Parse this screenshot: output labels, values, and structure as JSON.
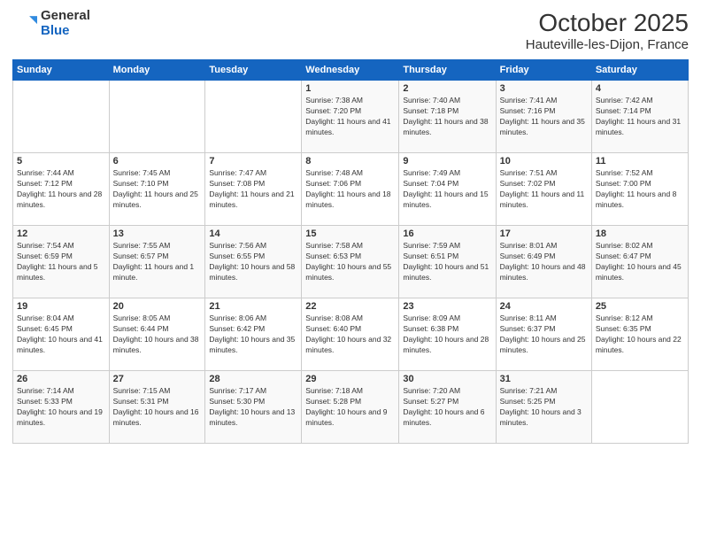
{
  "header": {
    "logo_general": "General",
    "logo_blue": "Blue",
    "month": "October 2025",
    "location": "Hauteville-les-Dijon, France"
  },
  "weekdays": [
    "Sunday",
    "Monday",
    "Tuesday",
    "Wednesday",
    "Thursday",
    "Friday",
    "Saturday"
  ],
  "weeks": [
    [
      {
        "day": "",
        "content": ""
      },
      {
        "day": "",
        "content": ""
      },
      {
        "day": "",
        "content": ""
      },
      {
        "day": "1",
        "content": "Sunrise: 7:38 AM\nSunset: 7:20 PM\nDaylight: 11 hours and 41 minutes."
      },
      {
        "day": "2",
        "content": "Sunrise: 7:40 AM\nSunset: 7:18 PM\nDaylight: 11 hours and 38 minutes."
      },
      {
        "day": "3",
        "content": "Sunrise: 7:41 AM\nSunset: 7:16 PM\nDaylight: 11 hours and 35 minutes."
      },
      {
        "day": "4",
        "content": "Sunrise: 7:42 AM\nSunset: 7:14 PM\nDaylight: 11 hours and 31 minutes."
      }
    ],
    [
      {
        "day": "5",
        "content": "Sunrise: 7:44 AM\nSunset: 7:12 PM\nDaylight: 11 hours and 28 minutes."
      },
      {
        "day": "6",
        "content": "Sunrise: 7:45 AM\nSunset: 7:10 PM\nDaylight: 11 hours and 25 minutes."
      },
      {
        "day": "7",
        "content": "Sunrise: 7:47 AM\nSunset: 7:08 PM\nDaylight: 11 hours and 21 minutes."
      },
      {
        "day": "8",
        "content": "Sunrise: 7:48 AM\nSunset: 7:06 PM\nDaylight: 11 hours and 18 minutes."
      },
      {
        "day": "9",
        "content": "Sunrise: 7:49 AM\nSunset: 7:04 PM\nDaylight: 11 hours and 15 minutes."
      },
      {
        "day": "10",
        "content": "Sunrise: 7:51 AM\nSunset: 7:02 PM\nDaylight: 11 hours and 11 minutes."
      },
      {
        "day": "11",
        "content": "Sunrise: 7:52 AM\nSunset: 7:00 PM\nDaylight: 11 hours and 8 minutes."
      }
    ],
    [
      {
        "day": "12",
        "content": "Sunrise: 7:54 AM\nSunset: 6:59 PM\nDaylight: 11 hours and 5 minutes."
      },
      {
        "day": "13",
        "content": "Sunrise: 7:55 AM\nSunset: 6:57 PM\nDaylight: 11 hours and 1 minute."
      },
      {
        "day": "14",
        "content": "Sunrise: 7:56 AM\nSunset: 6:55 PM\nDaylight: 10 hours and 58 minutes."
      },
      {
        "day": "15",
        "content": "Sunrise: 7:58 AM\nSunset: 6:53 PM\nDaylight: 10 hours and 55 minutes."
      },
      {
        "day": "16",
        "content": "Sunrise: 7:59 AM\nSunset: 6:51 PM\nDaylight: 10 hours and 51 minutes."
      },
      {
        "day": "17",
        "content": "Sunrise: 8:01 AM\nSunset: 6:49 PM\nDaylight: 10 hours and 48 minutes."
      },
      {
        "day": "18",
        "content": "Sunrise: 8:02 AM\nSunset: 6:47 PM\nDaylight: 10 hours and 45 minutes."
      }
    ],
    [
      {
        "day": "19",
        "content": "Sunrise: 8:04 AM\nSunset: 6:45 PM\nDaylight: 10 hours and 41 minutes."
      },
      {
        "day": "20",
        "content": "Sunrise: 8:05 AM\nSunset: 6:44 PM\nDaylight: 10 hours and 38 minutes."
      },
      {
        "day": "21",
        "content": "Sunrise: 8:06 AM\nSunset: 6:42 PM\nDaylight: 10 hours and 35 minutes."
      },
      {
        "day": "22",
        "content": "Sunrise: 8:08 AM\nSunset: 6:40 PM\nDaylight: 10 hours and 32 minutes."
      },
      {
        "day": "23",
        "content": "Sunrise: 8:09 AM\nSunset: 6:38 PM\nDaylight: 10 hours and 28 minutes."
      },
      {
        "day": "24",
        "content": "Sunrise: 8:11 AM\nSunset: 6:37 PM\nDaylight: 10 hours and 25 minutes."
      },
      {
        "day": "25",
        "content": "Sunrise: 8:12 AM\nSunset: 6:35 PM\nDaylight: 10 hours and 22 minutes."
      }
    ],
    [
      {
        "day": "26",
        "content": "Sunrise: 7:14 AM\nSunset: 5:33 PM\nDaylight: 10 hours and 19 minutes."
      },
      {
        "day": "27",
        "content": "Sunrise: 7:15 AM\nSunset: 5:31 PM\nDaylight: 10 hours and 16 minutes."
      },
      {
        "day": "28",
        "content": "Sunrise: 7:17 AM\nSunset: 5:30 PM\nDaylight: 10 hours and 13 minutes."
      },
      {
        "day": "29",
        "content": "Sunrise: 7:18 AM\nSunset: 5:28 PM\nDaylight: 10 hours and 9 minutes."
      },
      {
        "day": "30",
        "content": "Sunrise: 7:20 AM\nSunset: 5:27 PM\nDaylight: 10 hours and 6 minutes."
      },
      {
        "day": "31",
        "content": "Sunrise: 7:21 AM\nSunset: 5:25 PM\nDaylight: 10 hours and 3 minutes."
      },
      {
        "day": "",
        "content": ""
      }
    ]
  ]
}
